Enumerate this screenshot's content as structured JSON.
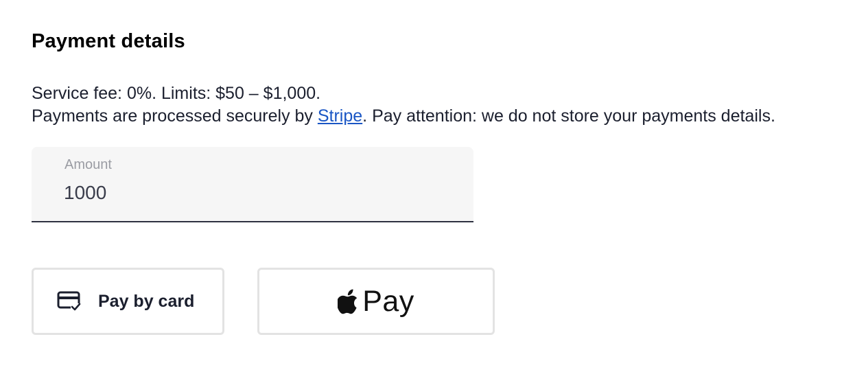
{
  "payment": {
    "title": "Payment details",
    "fee_line": "Service fee: 0%. Limits: $50 – $1,000.",
    "secure_prefix": "Payments are processed securely by ",
    "stripe_link": "Stripe",
    "secure_suffix": ". Pay attention: we do not store your payments details."
  },
  "amount": {
    "label": "Amount",
    "value": "1000"
  },
  "buttons": {
    "card_label": "Pay by card",
    "card_icon": "credit-card-check-icon",
    "apple_label": "Pay",
    "apple_icon": "apple-logo-icon"
  }
}
